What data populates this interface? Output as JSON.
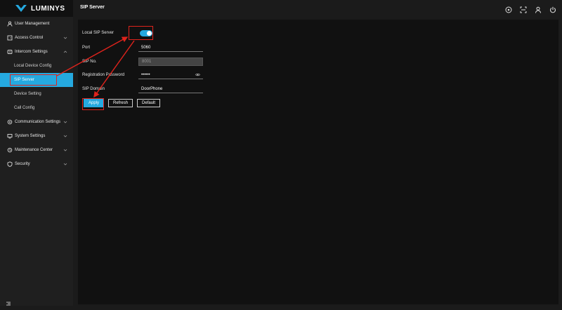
{
  "brand": {
    "name": "LUMINYS"
  },
  "header": {
    "title": "SIP Server",
    "icons": [
      "help-icon",
      "fullscreen-icon",
      "user-icon",
      "power-icon"
    ]
  },
  "sidebar": {
    "items": [
      {
        "label": "User Management",
        "icon": "user-icon"
      },
      {
        "label": "Access Control",
        "icon": "door-icon",
        "expandable": true
      },
      {
        "label": "Intercom Settings",
        "icon": "intercom-icon",
        "expanded": true
      },
      {
        "label": "Communication Settings",
        "icon": "network-icon",
        "expandable": true
      },
      {
        "label": "System Settings",
        "icon": "system-icon",
        "expandable": true
      },
      {
        "label": "Maintenance Center",
        "icon": "maintenance-icon",
        "expandable": true
      },
      {
        "label": "Security",
        "icon": "shield-icon",
        "expandable": true
      }
    ],
    "subitems": [
      {
        "label": "Local Device Config"
      },
      {
        "label": "SIP Server",
        "active": true
      },
      {
        "label": "Device Setting"
      },
      {
        "label": "Call Config"
      }
    ]
  },
  "form": {
    "local_sip_server": {
      "label": "Local SIP Server",
      "enabled": true
    },
    "port": {
      "label": "Port",
      "value": "5060"
    },
    "sip_no": {
      "label": "SIP No.",
      "value": "8001"
    },
    "registration_password": {
      "label": "Registration Password",
      "value": "••••••"
    },
    "sip_domain": {
      "label": "SIP Domain",
      "value": "DoorPhone"
    }
  },
  "buttons": {
    "apply": "Apply",
    "refresh": "Refresh",
    "default": "Default"
  },
  "colors": {
    "accent": "#25a9e0",
    "highlight": "#e0231c"
  }
}
